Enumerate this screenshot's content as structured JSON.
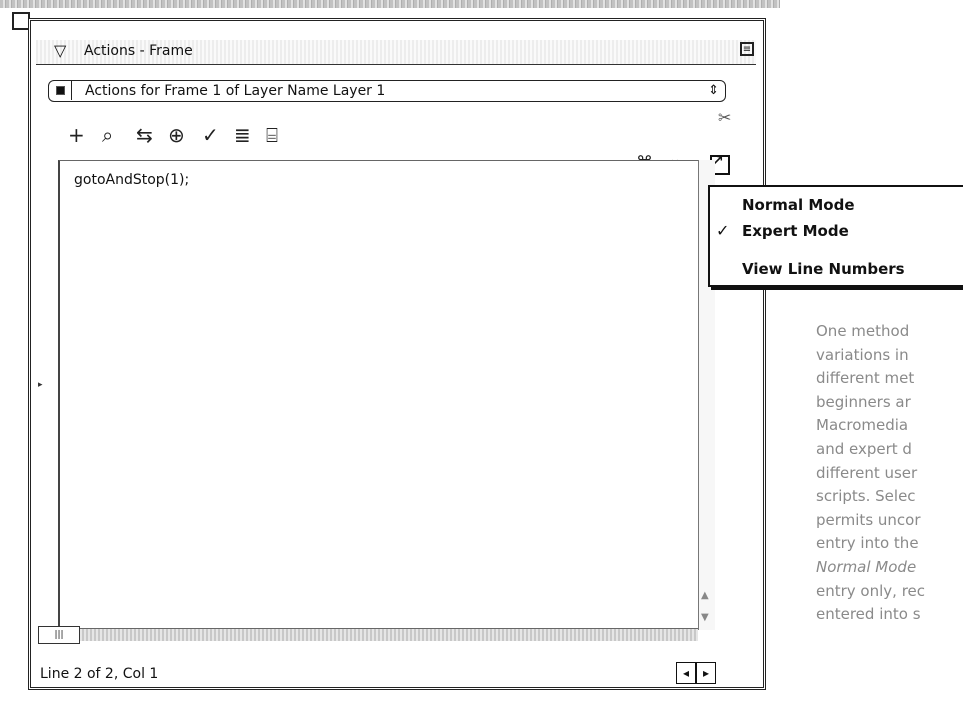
{
  "panel": {
    "title": "Actions - Frame",
    "collapse_glyph": "▽",
    "menu_glyph": "≡"
  },
  "target_selector": {
    "label": "Actions for Frame 1 of Layer Name Layer 1",
    "arrows_glyph": "⇕"
  },
  "toolbar": {
    "icons": [
      {
        "name": "add-statement-icon",
        "glyph": "+"
      },
      {
        "name": "find-icon",
        "glyph": "⌕"
      },
      {
        "name": "replace-icon",
        "glyph": "⇆"
      },
      {
        "name": "insert-target-path-icon",
        "glyph": "⊕"
      },
      {
        "name": "check-syntax-icon",
        "glyph": "✓"
      },
      {
        "name": "auto-format-icon",
        "glyph": "≣"
      },
      {
        "name": "show-code-hint-icon",
        "glyph": "⌸"
      }
    ],
    "right_icons": [
      {
        "name": "reference-icon",
        "glyph": "⌘"
      },
      {
        "name": "debug-options-icon",
        "glyph": "∞"
      }
    ],
    "view_options_glyph": "↗"
  },
  "script": {
    "line_1": "gotoAndStop(1);"
  },
  "status": {
    "text": "Line 2 of 2, Col 1",
    "nav_left": "◂",
    "nav_right": "▸",
    "grip": "|||"
  },
  "view_menu": {
    "items": [
      {
        "label": "Normal Mode",
        "checked": false
      },
      {
        "label": "Expert Mode",
        "checked": true
      },
      {
        "label": "View Line Numbers",
        "checked": false
      }
    ],
    "check_glyph": "✓"
  },
  "sidebar_text": {
    "lines": [
      "One method",
      "variations in",
      "different met",
      "beginners ar",
      "Macromedia",
      "and expert d",
      "different user",
      "scripts. Selec",
      "permits uncor",
      "entry into the",
      "Normal Mode",
      "entry only, rec",
      "entered into s"
    ]
  }
}
